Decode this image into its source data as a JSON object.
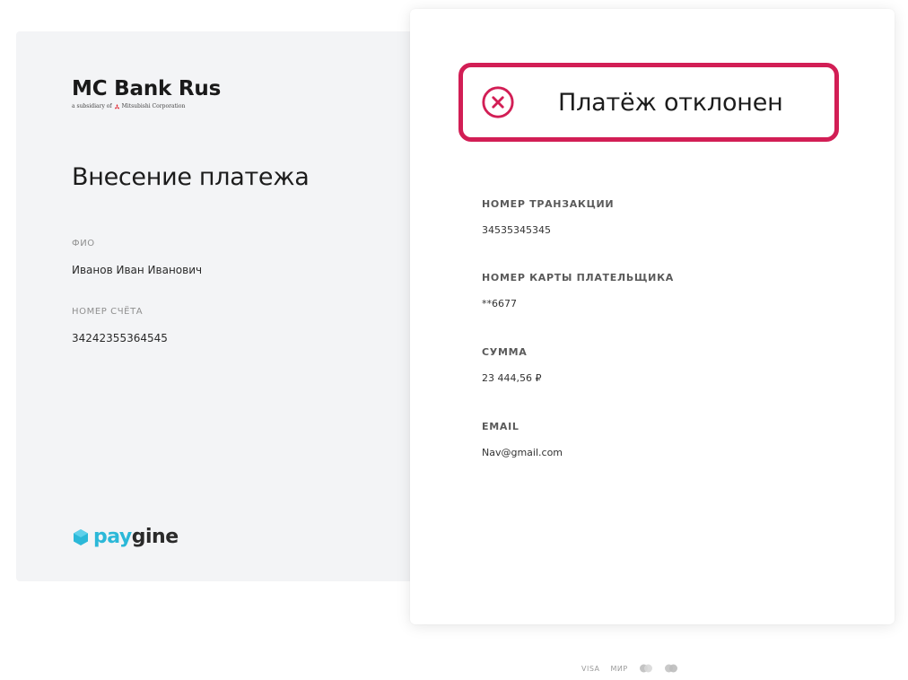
{
  "brand": {
    "name": "MC Bank Rus",
    "subtitle_prefix": "a subsidiary of",
    "subtitle_company": "Mitsubishi Corporation",
    "mark_icon": "mitsubishi-diamonds-icon",
    "mark_color": "#e0202b"
  },
  "left": {
    "title": "Внесение платежа",
    "fields": [
      {
        "label": "ФИО",
        "value": "Иванов Иван Иванович"
      },
      {
        "label": "НОМЕР СЧЁТА",
        "value": "34242355364545"
      }
    ],
    "provider": {
      "part1": "pay",
      "part2": "gine",
      "icon": "paygine-hexagon-icon",
      "color": "#2bb8d8"
    }
  },
  "status": {
    "text": "Платёж отклонен",
    "icon": "close-circle-icon",
    "accent": "#d21e55"
  },
  "details": [
    {
      "label": "НОМЕР ТРАНЗАКЦИИ",
      "value": "34535345345"
    },
    {
      "label": "НОМЕР КАРТЫ ПЛАТЕЛЬЩИКА",
      "value": "**6677"
    },
    {
      "label": "СУММА",
      "value": "23 444,56 ₽"
    },
    {
      "label": "EMAIL",
      "value": "Nav@gmail.com"
    }
  ],
  "footer": {
    "visa": "VISA",
    "mir": "МИР",
    "mastercard_icon": "mastercard-icon",
    "maestro_icon": "maestro-icon"
  }
}
